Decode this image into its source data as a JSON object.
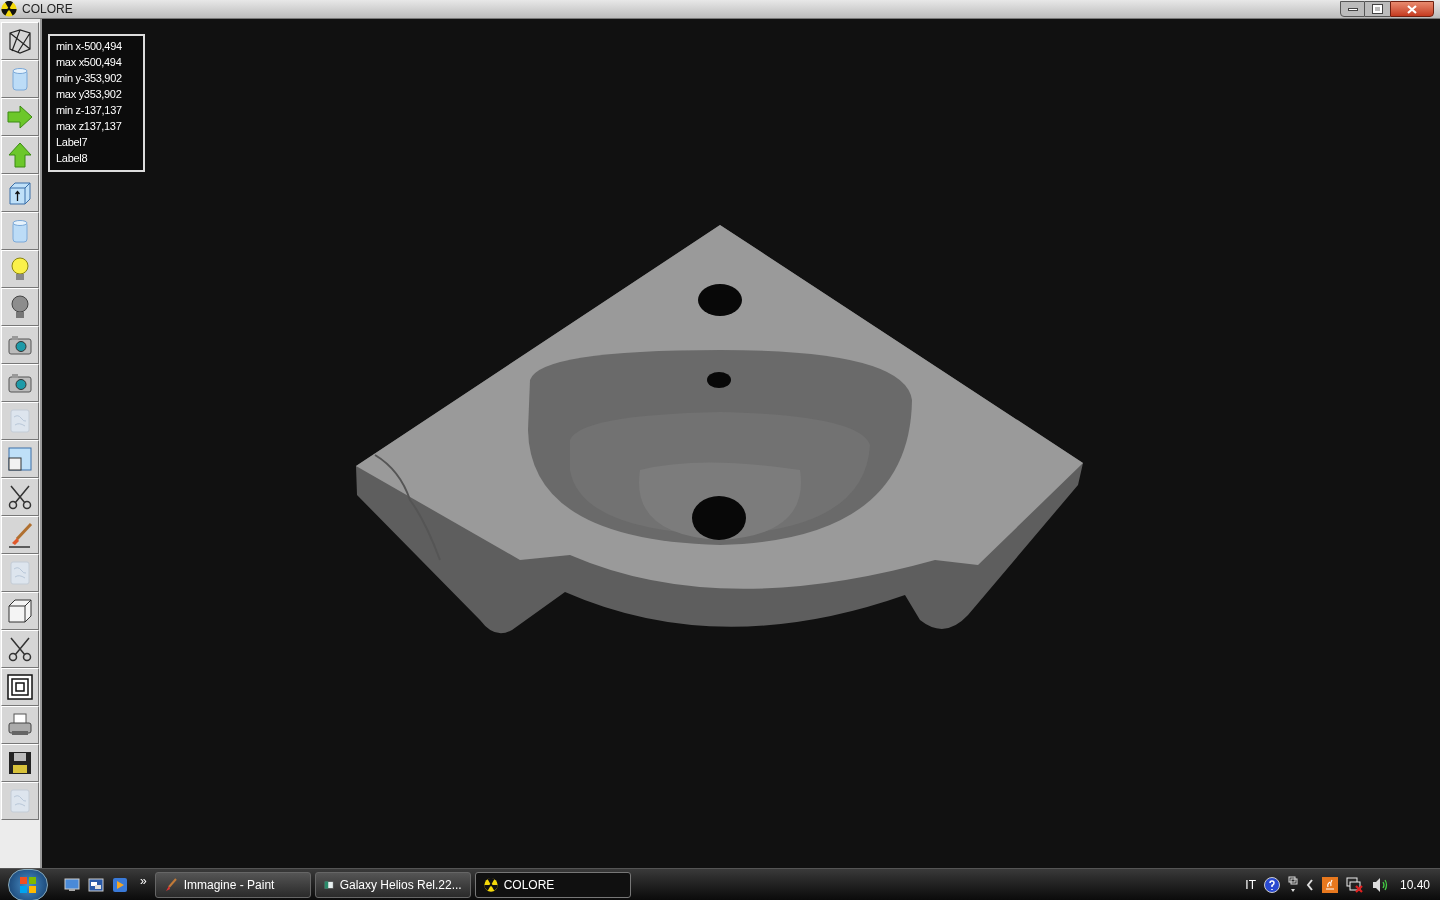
{
  "window": {
    "title": "COLORE"
  },
  "toolbar": [
    {
      "kind": "wireframe"
    },
    {
      "kind": "cylinder"
    },
    {
      "kind": "arrow-right"
    },
    {
      "kind": "arrow-up"
    },
    {
      "kind": "box-arrow"
    },
    {
      "kind": "cylinder"
    },
    {
      "kind": "bulb-on"
    },
    {
      "kind": "bulb-off"
    },
    {
      "kind": "camera"
    },
    {
      "kind": "camera"
    },
    {
      "kind": "texture"
    },
    {
      "kind": "window"
    },
    {
      "kind": "scissors"
    },
    {
      "kind": "brush"
    },
    {
      "kind": "texture"
    },
    {
      "kind": "cube"
    },
    {
      "kind": "scissors"
    },
    {
      "kind": "squares"
    },
    {
      "kind": "printer"
    },
    {
      "kind": "floppy"
    },
    {
      "kind": "texture"
    }
  ],
  "info_labels": [
    "min x-500,494",
    "max x500,494",
    "min y-353,902",
    "max y353,902",
    "min z-137,137",
    "max z137,137",
    "Label7",
    "Label8"
  ],
  "taskbar": {
    "chevron": "»",
    "tasks": [
      {
        "label": "Immagine - Paint",
        "kind": "paint",
        "selected": false
      },
      {
        "label": "Galaxy Helios  Rel.22...",
        "kind": "app",
        "selected": false
      },
      {
        "label": "COLORE",
        "kind": "radiation",
        "selected": true
      }
    ],
    "language": "IT",
    "clock": "10.40"
  }
}
